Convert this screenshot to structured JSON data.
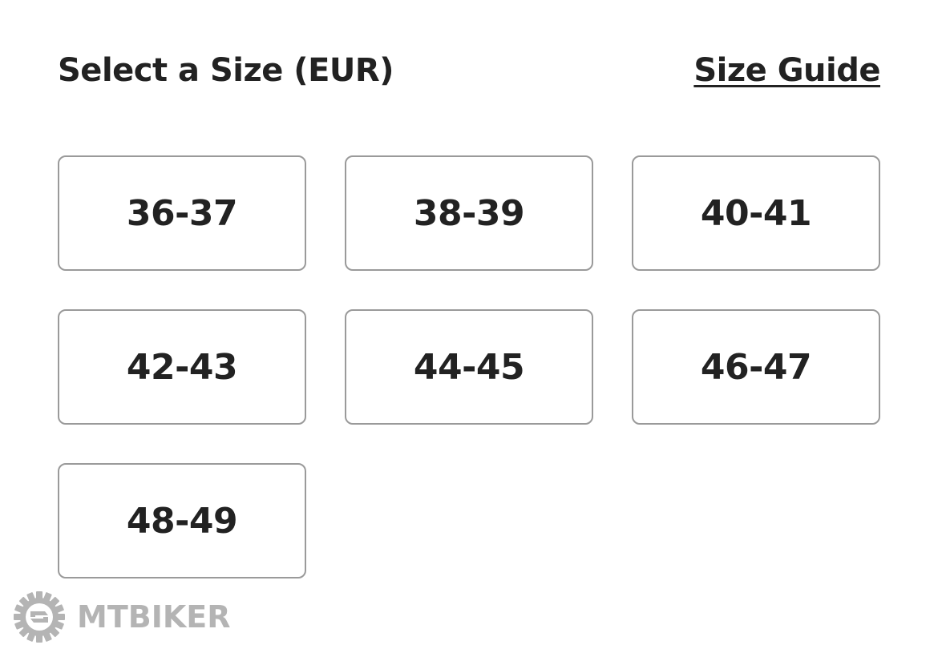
{
  "header": {
    "title": "Select a Size (EUR)",
    "size_guide_label": "Size Guide"
  },
  "sizes": [
    {
      "label": "36-37"
    },
    {
      "label": "38-39"
    },
    {
      "label": "40-41"
    },
    {
      "label": "42-43"
    },
    {
      "label": "44-45"
    },
    {
      "label": "46-47"
    },
    {
      "label": "48-49"
    }
  ],
  "watermark": {
    "icon": "gear-s-logo-icon",
    "text": "MTBIKER"
  },
  "colors": {
    "text": "#222222",
    "border": "#9a9a9a",
    "watermark": "#9b9b9b",
    "background": "#ffffff"
  }
}
